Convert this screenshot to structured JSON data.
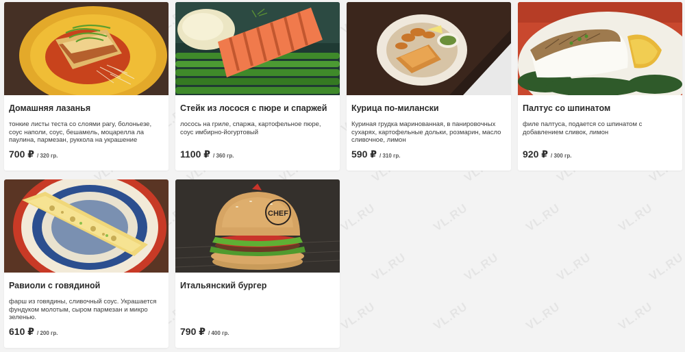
{
  "menu": {
    "items": [
      {
        "title": "Домашняя лазанья",
        "description": "тонкие листы теста со слоями рагу, болоньезе, соус наполи, соус, бешамель, моцарелла ла паулина,  пармезан, руккола на украшение",
        "price": "700 ₽",
        "weight": "/ 320 гр.",
        "photo": "lasagna-photo"
      },
      {
        "title": "Стейк из лосося с пюре и спаржей",
        "description": "лосось на гриле, спаржа, картофельное пюре, соус имбирно-йогуртовый",
        "price": "1100 ₽",
        "weight": "/ 360 гр.",
        "photo": "salmon-photo"
      },
      {
        "title": "Курица по-милански",
        "description": "Куриная грудка маринованная, в панировочных сухарях, картофельные дольки, розмарин, масло сливочное, лимон",
        "price": "590 ₽",
        "weight": "/ 310 гр.",
        "photo": "chicken-photo"
      },
      {
        "title": "Палтус со шпинатом",
        "description": "филе палтуса, подается со шпинатом с добавлением сливок, лимон",
        "price": "920 ₽",
        "weight": "/ 300 гр.",
        "photo": "halibut-photo"
      },
      {
        "title": "Равиоли с говядиной",
        "description": "фарш из говядины, сливочный соус. Украшается фундуком молотым, сыром пармезан и микро зеленью.",
        "price": "610 ₽",
        "weight": "/ 200 гр.",
        "photo": "ravioli-photo"
      },
      {
        "title": "Итальянский бургер",
        "description": "",
        "price": "790 ₽",
        "weight": "/ 400 гр.",
        "photo": "burger-photo"
      }
    ]
  },
  "watermark": {
    "text": "VL.RU"
  },
  "photo_labels": {
    "burger_bun": "CHEF"
  },
  "colors": {
    "page_bg": "#f3f3f3",
    "card_bg": "#ffffff",
    "text": "#2b2b2b"
  }
}
